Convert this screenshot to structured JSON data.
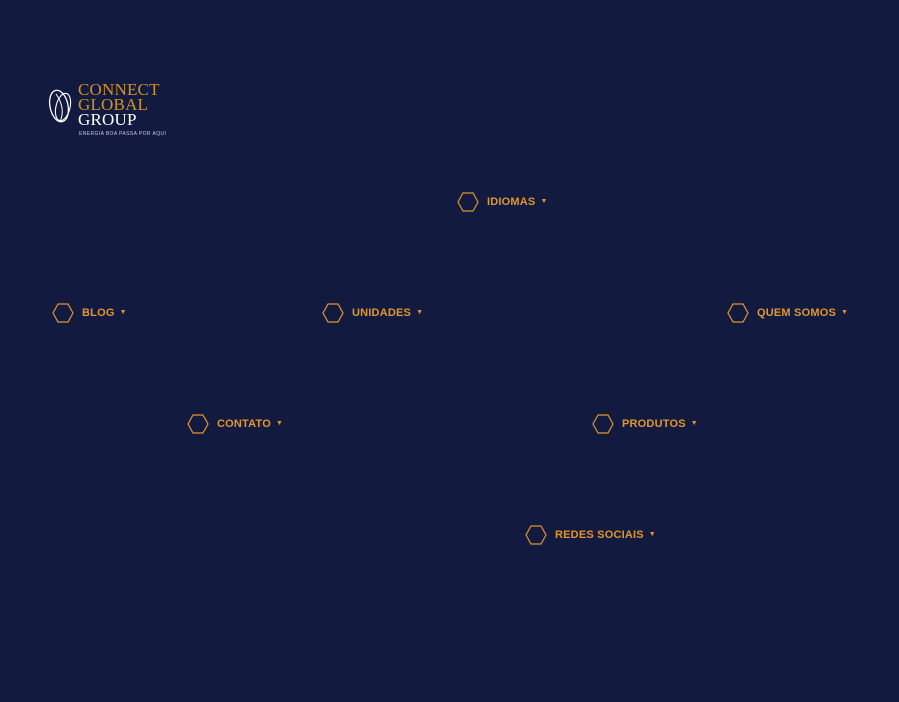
{
  "logo": {
    "line1": "CONNECT",
    "line2": "GLOBAL",
    "line3": "GROUP",
    "tagline": "ENERGIA BOA PASSA POR AQUI"
  },
  "menu": {
    "idiomas": "IDIOMAS",
    "blog": "BLOG",
    "unidades": "UNIDADES",
    "quem_somos": "QUEM SOMOS",
    "contato": "CONTATO",
    "produtos": "PRODUTOS",
    "redes_sociais": "REDES SOCIAIS"
  },
  "icons": {
    "menu_marker": "hexagon-icon",
    "dropdown": "caret-down-icon"
  },
  "colors": {
    "background": "#121a40",
    "accent": "#e0962a",
    "logo_gold": "#d4931f",
    "logo_white": "#ffffff"
  }
}
